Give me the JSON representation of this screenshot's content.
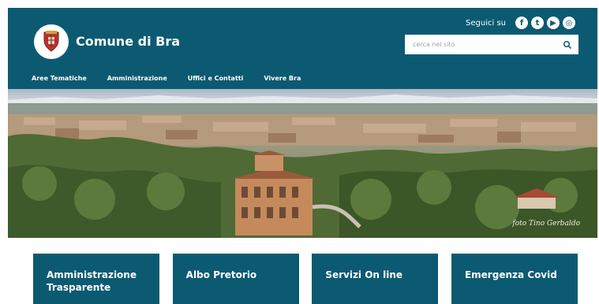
{
  "brand": {
    "site_name": "Comune di Bra",
    "crest_icon": "coat-of-arms-icon"
  },
  "social": {
    "label": "Seguici su",
    "icons": [
      {
        "name": "facebook-icon",
        "glyph": "f"
      },
      {
        "name": "twitter-icon",
        "glyph": "t"
      },
      {
        "name": "youtube-icon",
        "glyph": "▶"
      },
      {
        "name": "instagram-icon",
        "glyph": "◎"
      }
    ]
  },
  "search": {
    "placeholder": "cerca nel sito",
    "icon": "search-icon"
  },
  "nav": {
    "items": [
      "Aree Tematiche",
      "Amministrazione",
      "Uffici e Contatti",
      "Vivere Bra"
    ]
  },
  "hero": {
    "photo_credit": "foto Tino Gerbaldo"
  },
  "cards": [
    {
      "title": "Amministrazione Trasparente"
    },
    {
      "title": "Albo Pretorio"
    },
    {
      "title": "Servizi On line"
    },
    {
      "title": "Emergenza Covid"
    }
  ],
  "colors": {
    "primary": "#0b5a72",
    "text_light": "#ffffff"
  }
}
